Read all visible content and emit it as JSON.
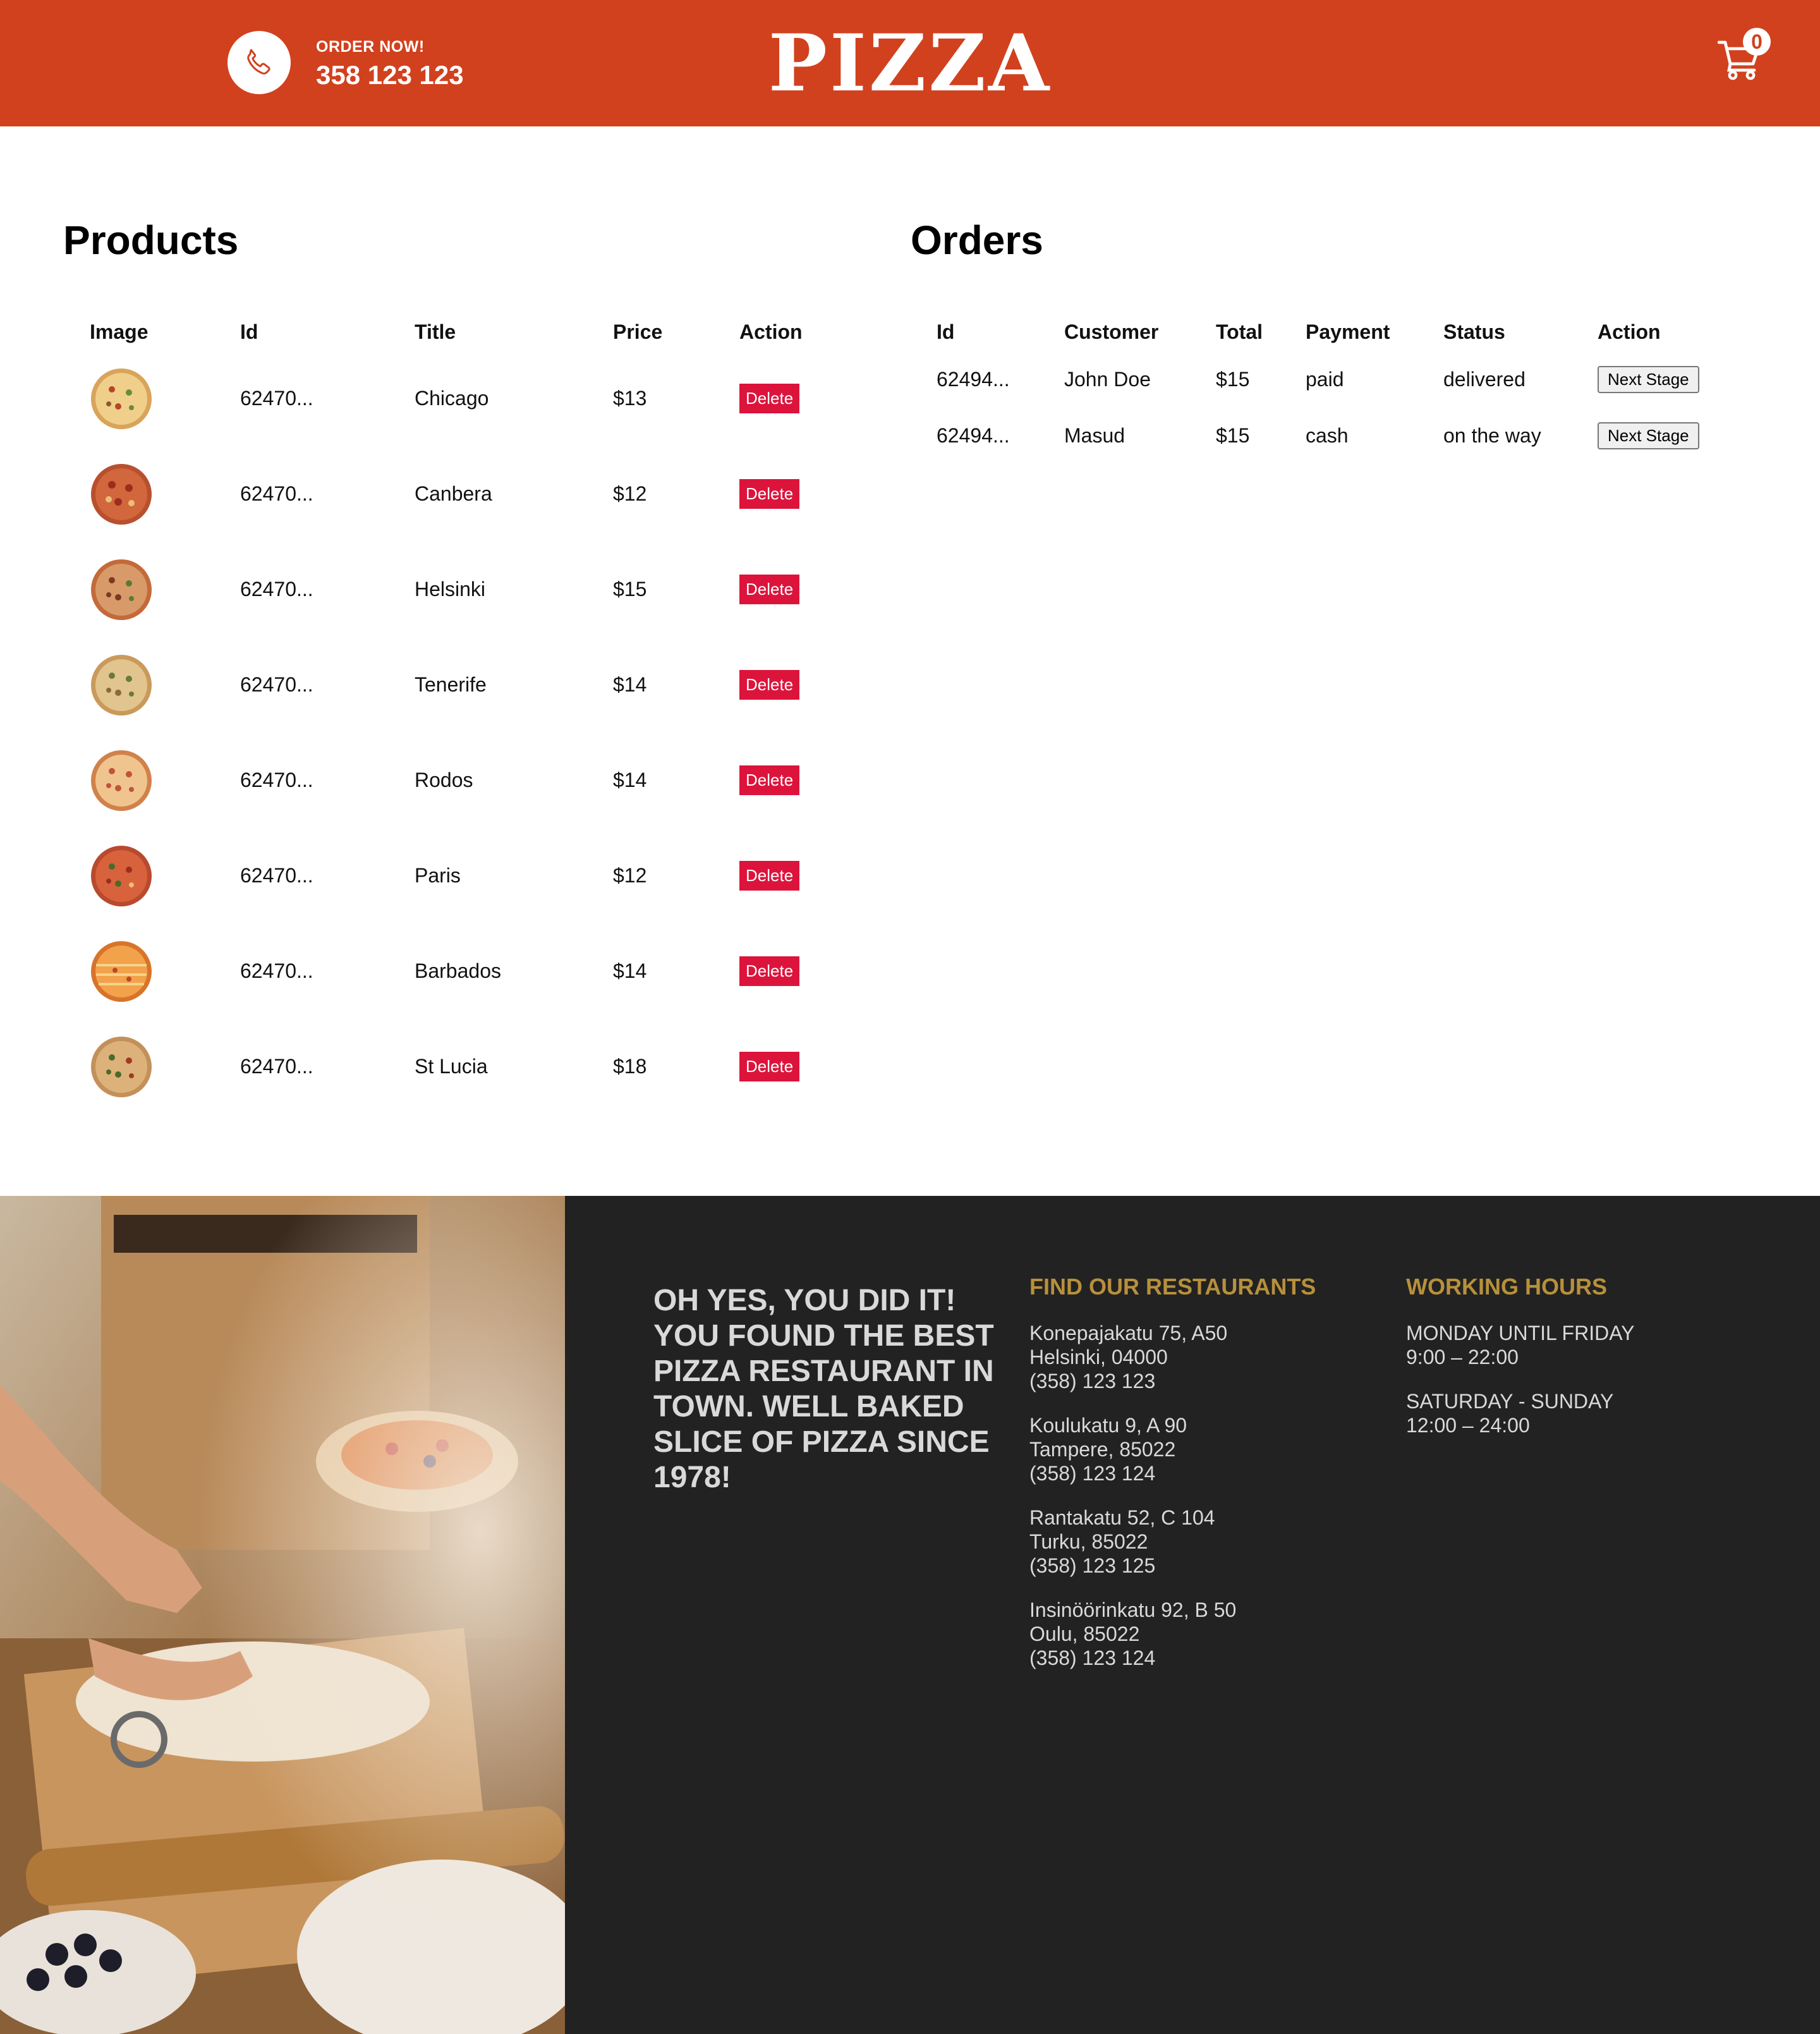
{
  "navbar": {
    "order_now": "ORDER NOW!",
    "phone": "358 123 123",
    "logo": "PIZZA",
    "cart_count": "0",
    "brand_color": "#d1411e"
  },
  "products": {
    "title": "Products",
    "headers": [
      "Image",
      "Id",
      "Title",
      "Price",
      "Action"
    ],
    "rows": [
      {
        "id": "62470...",
        "title": "Chicago",
        "price": "$13",
        "action": "Delete"
      },
      {
        "id": "62470...",
        "title": "Canbera",
        "price": "$12",
        "action": "Delete"
      },
      {
        "id": "62470...",
        "title": "Helsinki",
        "price": "$15",
        "action": "Delete"
      },
      {
        "id": "62470...",
        "title": "Tenerife",
        "price": "$14",
        "action": "Delete"
      },
      {
        "id": "62470...",
        "title": "Rodos",
        "price": "$14",
        "action": "Delete"
      },
      {
        "id": "62470...",
        "title": "Paris",
        "price": "$12",
        "action": "Delete"
      },
      {
        "id": "62470...",
        "title": "Barbados",
        "price": "$14",
        "action": "Delete"
      },
      {
        "id": "62470...",
        "title": "St Lucia",
        "price": "$18",
        "action": "Delete"
      }
    ]
  },
  "orders": {
    "title": "Orders",
    "headers": [
      "Id",
      "Customer",
      "Total",
      "Payment",
      "Status",
      "Action"
    ],
    "rows": [
      {
        "id": "62494...",
        "customer": "John Doe",
        "total": "$15",
        "payment": "paid",
        "status": "delivered",
        "action": "Next Stage"
      },
      {
        "id": "62494...",
        "customer": "Masud",
        "total": "$15",
        "payment": "cash",
        "status": "on the way",
        "action": "Next Stage"
      }
    ]
  },
  "footer": {
    "motto": "OH YES, YOU DID IT! YOU FOUND THE BEST PIZZA RESTAURANT IN TOWN. WELL BAKED SLICE OF PIZZA SINCE 1978!",
    "restaurants_title": "FIND OUR RESTAURANTS",
    "restaurants": [
      {
        "address": "Konepajakatu 75, A50",
        "city": "Helsinki, 04000",
        "phone": "(358) 123 123"
      },
      {
        "address": "Koulukatu 9, A 90",
        "city": "Tampere, 85022",
        "phone": "(358) 123 124"
      },
      {
        "address": "Rantakatu 52, C 104",
        "city": "Turku, 85022",
        "phone": "(358) 123 125"
      },
      {
        "address": "Insinöörinkatu 92, B 50",
        "city": "Oulu, 85022",
        "phone": "(358) 123 124"
      }
    ],
    "hours_title": "WORKING HOURS",
    "hours": [
      {
        "days": "MONDAY UNTIL FRIDAY",
        "time": "9:00 – 22:00"
      },
      {
        "days": "SATURDAY - SUNDAY",
        "time": "12:00 – 24:00"
      }
    ],
    "accent_color": "#b7903c"
  }
}
